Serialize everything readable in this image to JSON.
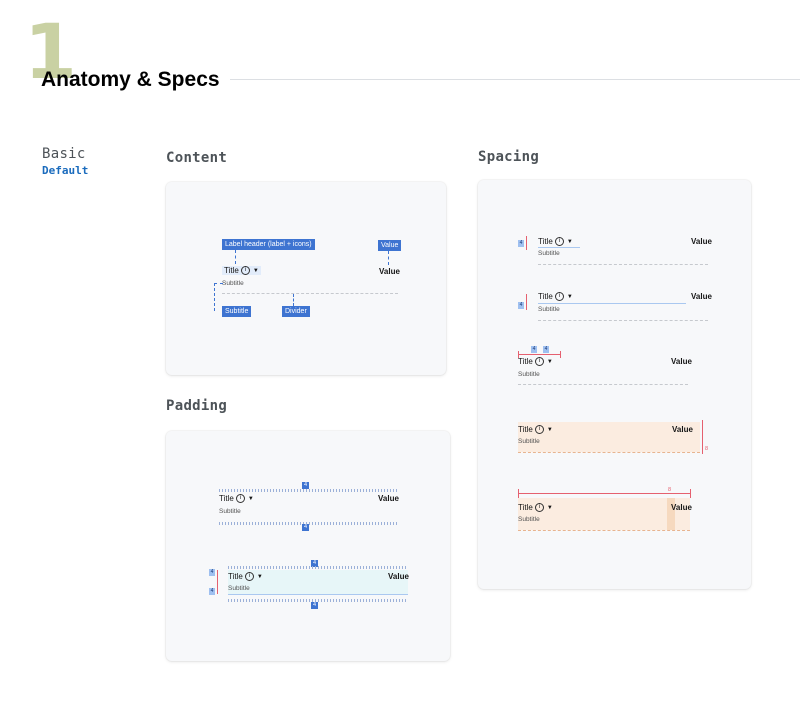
{
  "header": {
    "number": "1",
    "title": "Anatomy & Specs"
  },
  "variant": {
    "name": "Basic",
    "state": "Default"
  },
  "content": {
    "label": "Content",
    "tags": {
      "label_header": "Label header (label + icons)",
      "value": "Value",
      "subtitle": "Subtitle",
      "divider": "Divider"
    },
    "row": {
      "title": "Title",
      "subtitle": "Subtitle",
      "value": "Value"
    }
  },
  "padding": {
    "label": "Padding",
    "row": {
      "title": "Title",
      "subtitle": "Subtitle",
      "value": "Value"
    },
    "spacing_value": "4"
  },
  "spacing": {
    "label": "Spacing",
    "row": {
      "title": "Title",
      "subtitle": "Subtitle",
      "value": "Value"
    },
    "value_4": "4",
    "value_8": "8"
  },
  "colors": {
    "accent": "#3e74d1",
    "variant_blue": "#1a6bbd",
    "measure_red": "#e5606f",
    "number_tint": "#c9d1a3"
  },
  "icons": [
    "info-icon",
    "chevron-down-icon"
  ]
}
